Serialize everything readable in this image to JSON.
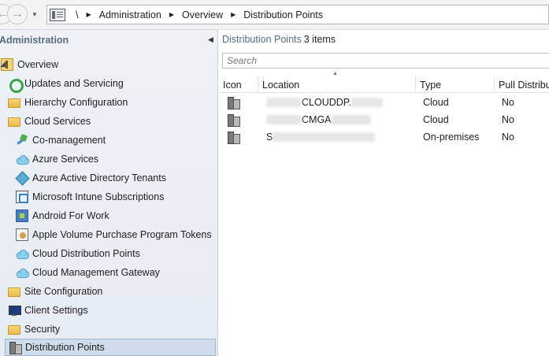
{
  "breadcrumb": {
    "root": "\\",
    "items": [
      "Administration",
      "Overview",
      "Distribution Points"
    ]
  },
  "sidebar": {
    "title": "Administration",
    "items": [
      {
        "label": "Overview",
        "icon": "overview-icon"
      },
      {
        "label": "Updates and Servicing",
        "icon": "updates-icon"
      },
      {
        "label": "Hierarchy Configuration",
        "icon": "folder-icon"
      },
      {
        "label": "Cloud Services",
        "icon": "folder-icon"
      },
      {
        "label": "Co-management",
        "icon": "co-management-icon"
      },
      {
        "label": "Azure Services",
        "icon": "cloud-icon"
      },
      {
        "label": "Azure Active Directory Tenants",
        "icon": "azure-ad-icon"
      },
      {
        "label": "Microsoft Intune Subscriptions",
        "icon": "intune-icon"
      },
      {
        "label": "Android For Work",
        "icon": "android-icon"
      },
      {
        "label": "Apple Volume Purchase Program Tokens",
        "icon": "apple-vpp-icon"
      },
      {
        "label": "Cloud Distribution Points",
        "icon": "cloud-icon"
      },
      {
        "label": "Cloud Management Gateway",
        "icon": "cloud-icon"
      },
      {
        "label": "Site Configuration",
        "icon": "folder-icon"
      },
      {
        "label": "Client Settings",
        "icon": "monitor-icon"
      },
      {
        "label": "Security",
        "icon": "folder-icon"
      },
      {
        "label": "Distribution Points",
        "icon": "distribution-point-icon"
      }
    ]
  },
  "main": {
    "title": "Distribution Points",
    "count": "3 items",
    "search_placeholder": "Search",
    "columns": [
      "Icon",
      "Location",
      "Type",
      "Pull Distribu"
    ],
    "rows": [
      {
        "location": "CLOUDDP.",
        "type": "Cloud",
        "pull": "No"
      },
      {
        "location": "CMGA",
        "type": "Cloud",
        "pull": "No"
      },
      {
        "location": "S",
        "type": "On-premises",
        "pull": "No"
      }
    ]
  },
  "colors": {
    "sidebar_bg": "#e9eef4",
    "selected_bg": "#cfdcec",
    "title_text": "#5a6b7d"
  }
}
